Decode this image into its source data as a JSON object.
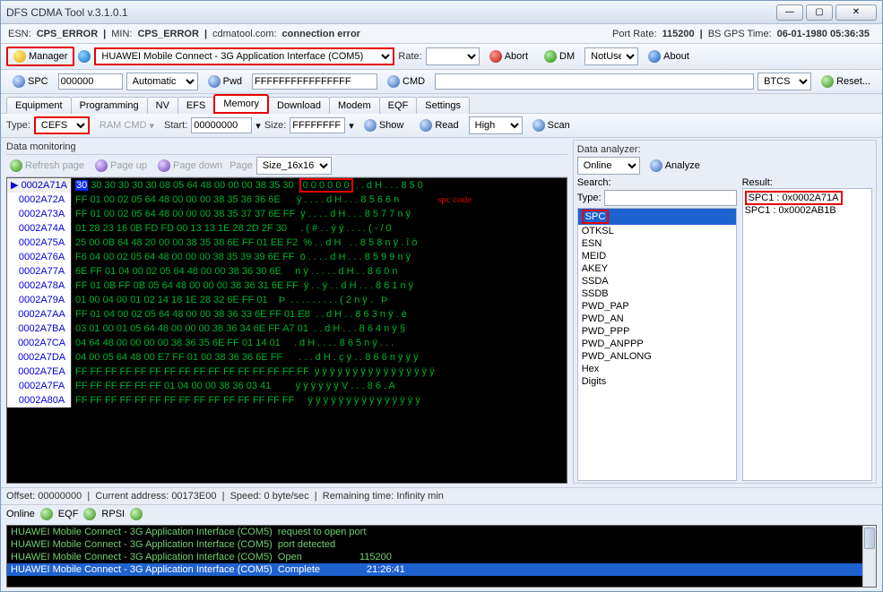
{
  "window": {
    "title": "DFS CDMA Tool v.3.1.0.1"
  },
  "status": {
    "esn_label": "ESN:",
    "esn": "CPS_ERROR",
    "min_label": "MIN:",
    "min": "CPS_ERROR",
    "site": "cdmatool.com:",
    "conn": "connection error",
    "port_rate_label": "Port Rate:",
    "port_rate": "115200",
    "gps_label": "BS GPS Time:",
    "gps": "06-01-1980 05:36:35"
  },
  "toolbarA": {
    "manager": "Manager",
    "device": "HUAWEI Mobile Connect - 3G Application Interface (COM5)",
    "rate_label": "Rate:",
    "abort": "Abort",
    "dm": "DM",
    "dm_mode": "NotUse",
    "about": "About"
  },
  "toolbarB": {
    "spc": "SPC",
    "spc_val": "000000",
    "spc_mode": "Automatic",
    "pwd": "Pwd",
    "pwd_val": "FFFFFFFFFFFFFFFF",
    "cmd": "CMD",
    "cmd_val": "",
    "target": "BTCS",
    "reset": "Reset..."
  },
  "tabs": [
    "Equipment",
    "Programming",
    "NV",
    "EFS",
    "Memory",
    "Download",
    "Modem",
    "EQF",
    "Settings"
  ],
  "tabs_active": "Memory",
  "memory_bar": {
    "type_label": "Type:",
    "type": "CEFS",
    "ramcmd": "RAM CMD",
    "start_label": "Start:",
    "start": "00000000",
    "size_label": "Size:",
    "size": "FFFFFFFF",
    "show": "Show",
    "read": "Read",
    "speed": "High",
    "scan": "Scan"
  },
  "monitor": {
    "title": "Data monitoring",
    "refresh": "Refresh page",
    "pageup": "Page up",
    "pagedown": "Page down",
    "page_label": "Page",
    "page_size": "Size_16x16"
  },
  "analyzer": {
    "title": "Data analyzer:",
    "mode": "Online",
    "analyze": "Analyze",
    "search_label": "Search:",
    "type_label": "Type:",
    "type_val": "",
    "result_label": "Result:",
    "list": [
      "SPC",
      "OTKSL",
      "ESN",
      "MEID",
      "AKEY",
      "SSDA",
      "SSDB",
      "PWD_PAP",
      "PWD_AN",
      "PWD_PPP",
      "PWD_ANPPP",
      "PWD_ANLONG",
      "Hex",
      "Digits"
    ],
    "list_sel": "SPC",
    "results": [
      "SPC1 : 0x0002A71A",
      "SPC1 : 0x0002AB1B"
    ]
  },
  "hex": {
    "spc_label": "spc code",
    "rows": [
      {
        "addr": "0002A71A",
        "sel": true,
        "bytes": "30 30 30 30 30 30 08 05 64 48 00 00 00 38 35 30",
        "asc": "0 0 0 0 0 0 . . d H . . . 8 5 0"
      },
      {
        "addr": "0002A72A",
        "bytes": "FF 01 00 02 05 64 48 00 00 00 38 35 36 36 6E    ",
        "asc": "ÿ . . . . d H . . . 8 5 6 6 n"
      },
      {
        "addr": "0002A73A",
        "bytes": "FF 01 00 02 05 64 48 00 00 00 38 35 37 37 6E FF",
        "asc": "ÿ . . . . d H . . . 8 5 7 7 n ÿ"
      },
      {
        "addr": "0002A74A",
        "bytes": "01 28 23 16 0B FD FD 00 13 13 1E 28 2D 2F 30   ",
        "asc": ". ( # . . ý ý . . . . ( - / 0"
      },
      {
        "addr": "0002A75A",
        "bytes": "25 00 0B 64 48 20 00 00 38 35 38 6E FF 01 EE F2",
        "asc": "% . . d H   . . 8 5 8 n ÿ . î ò"
      },
      {
        "addr": "0002A76A",
        "bytes": "F6 04 00 02 05 64 48 00 00 00 38 35 39 39 6E FF",
        "asc": "ö . . . . d H . . . 8 5 9 9 n ÿ"
      },
      {
        "addr": "0002A77A",
        "bytes": "6E FF 01 04 00 02 05 64 48 00 00 38 36 30 6E   ",
        "asc": "n ÿ . . . . . d H . . 8 6 0 n"
      },
      {
        "addr": "0002A78A",
        "bytes": "FF 01 0B FF 0B 05 64 48 00 00 00 38 36 31 6E FF",
        "asc": "ÿ . . ÿ . . d H . . . 8 6 1 n ÿ"
      },
      {
        "addr": "0002A79A",
        "bytes": "01 00 04 00 01 02 14 18 1E 28 32 6E FF 01    Þ",
        "asc": ". . . . . . . . . ( 2 n ÿ .   Þ"
      },
      {
        "addr": "0002A7AA",
        "bytes": "FF 01 04 00 02 05 64 48 00 00 38 36 33 6E FF 01 E8",
        "asc": ". . d H . . 8 6 3 n ÿ . è"
      },
      {
        "addr": "0002A7BA",
        "bytes": "03 01 00 01 05 64 48 00 00 00 38 36 34 6E FF A7 01",
        "asc": ". . d H . . . 8 6 4 n ÿ §"
      },
      {
        "addr": "0002A7CA",
        "bytes": "04 64 48 00 00 00 00 38 36 35 6E FF 01 14 01   ",
        "asc": ". d H . . . . 8 6 5 n ÿ . . ."
      },
      {
        "addr": "0002A7DA",
        "bytes": "04 00 05 64 48 00 E7 FF 01 00 38 36 36 6E FF    ",
        "asc": ". . . d H . ç ÿ . . 8 6 6 n ÿ ÿ ÿ"
      },
      {
        "addr": "0002A7EA",
        "bytes": "FF FF FF FF FF FF FF FF FF FF FF FF FF FF FF FF",
        "asc": "ÿ ÿ ÿ ÿ ÿ ÿ ÿ ÿ ÿ ÿ ÿ ÿ ÿ ÿ ÿ ÿ"
      },
      {
        "addr": "0002A7FA",
        "bytes": "FF FF FF FF FF FF 01 04 00 00 38 36 03 41       ",
        "asc": "ÿ ÿ ÿ ÿ ÿ ÿ V . . . 8 6 . A"
      },
      {
        "addr": "0002A80A",
        "bytes": "FF FF FF FF FF FF FF FF FF FF FF FF FF FF FF   ",
        "asc": "ÿ ÿ ÿ ÿ ÿ ÿ ÿ ÿ ÿ ÿ ÿ ÿ ÿ ÿ ÿ"
      }
    ]
  },
  "footer": {
    "offset_label": "Offset:",
    "offset": "00000000",
    "curr_label": "Current address:",
    "curr": "00173E00",
    "speed_label": "Speed:",
    "speed": "0",
    "speed_unit": "byte/sec",
    "remain_label": "Remaining time:",
    "remain": "Infinity",
    "remain_unit": "min"
  },
  "onlinebar": {
    "online": "Online",
    "eqf": "EQF",
    "rpsi": "RPSI"
  },
  "log": [
    {
      "a": "HUAWEI Mobile Connect - 3G Application Interface (COM5) ",
      "b": "request to open port",
      "c": ""
    },
    {
      "a": "HUAWEI Mobile Connect - 3G Application Interface (COM5) ",
      "b": "port detected",
      "c": ""
    },
    {
      "a": "HUAWEI Mobile Connect - 3G Application Interface (COM5) ",
      "b": "Open",
      "c": "115200"
    },
    {
      "a": "HUAWEI Mobile Connect - 3G Application Interface (COM5) ",
      "b": "Complete",
      "c": "21:26:41",
      "sel": true
    }
  ]
}
